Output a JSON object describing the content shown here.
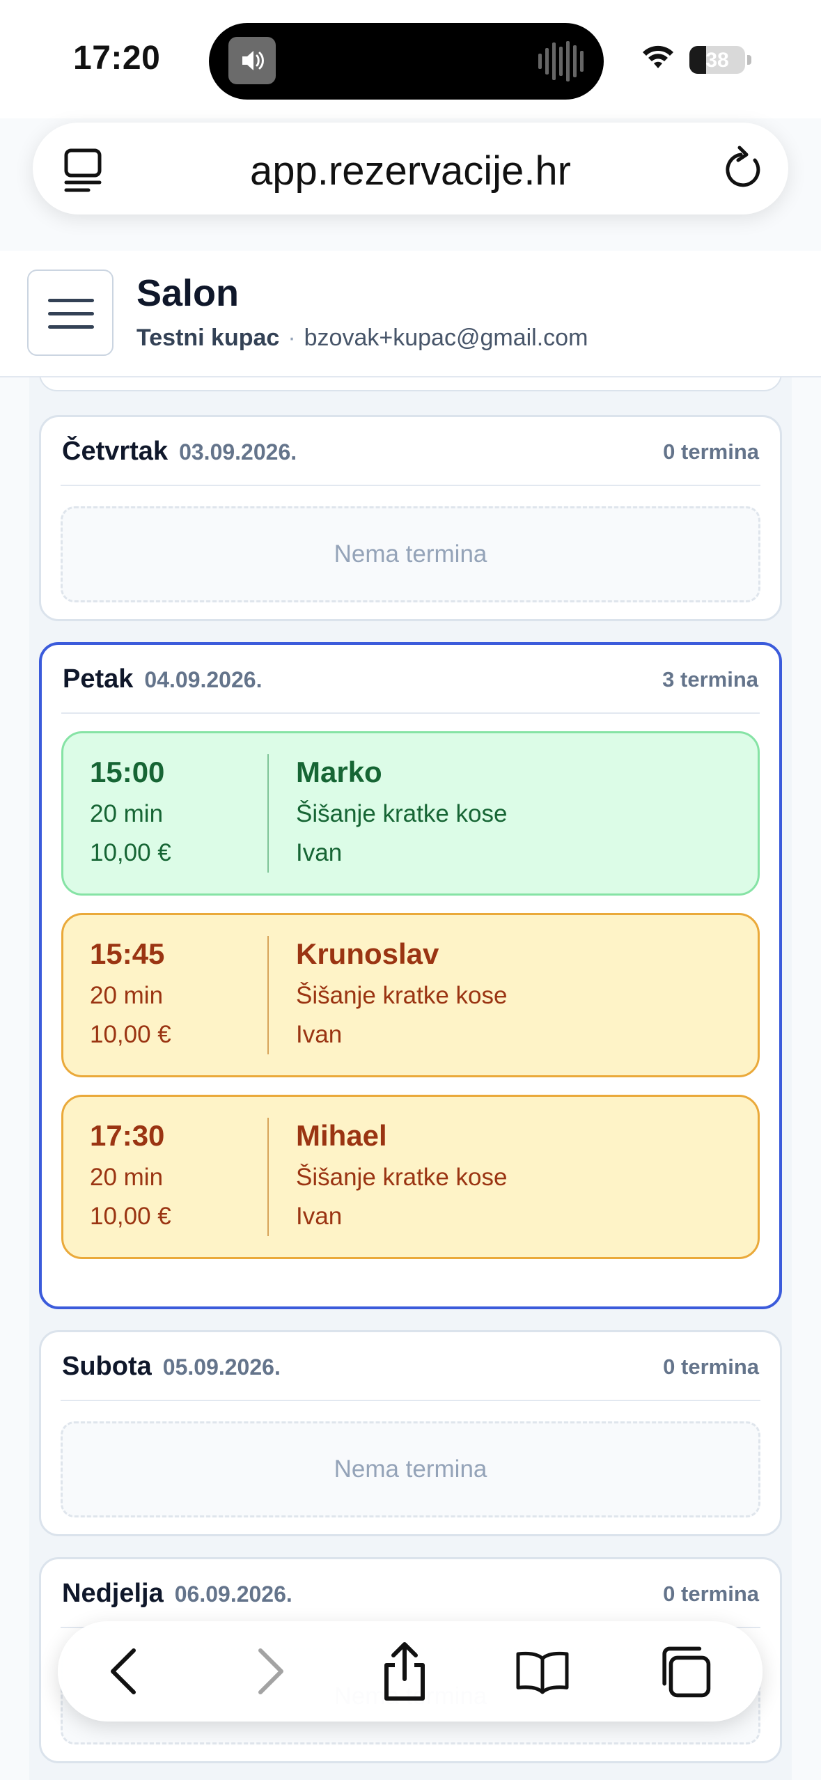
{
  "status_bar": {
    "time": "17:20",
    "battery": "38"
  },
  "browser": {
    "url": "app.rezervacije.hr"
  },
  "header": {
    "title": "Salon",
    "customer": "Testni kupac",
    "separator": "·",
    "email": "bzovak+kupac@gmail.com"
  },
  "days": [
    {
      "name": "Četvrtak",
      "date": "03.09.2026.",
      "count": "0 termina",
      "empty_text": "Nema termina"
    },
    {
      "name": "Petak",
      "date": "04.09.2026.",
      "count": "3 termina",
      "appointments": [
        {
          "time": "15:00",
          "duration": "20 min",
          "price": "10,00 €",
          "client": "Marko",
          "service": "Šišanje kratke kose",
          "staff": "Ivan",
          "status_color": "#dcfce7"
        },
        {
          "time": "15:45",
          "duration": "20 min",
          "price": "10,00 €",
          "client": "Krunoslav",
          "service": "Šišanje kratke kose",
          "staff": "Ivan",
          "status_color": "#fef3c7"
        },
        {
          "time": "17:30",
          "duration": "20 min",
          "price": "10,00 €",
          "client": "Mihael",
          "service": "Šišanje kratke kose",
          "staff": "Ivan",
          "status_color": "#fef3c7"
        }
      ]
    },
    {
      "name": "Subota",
      "date": "05.09.2026.",
      "count": "0 termina",
      "empty_text": "Nema termina"
    },
    {
      "name": "Nedjelja",
      "date": "06.09.2026.",
      "count": "0 termina",
      "empty_text": "Nema termina"
    }
  ],
  "toolbar": {
    "icons": [
      "back-icon",
      "forward-icon",
      "share-icon",
      "bookmarks-icon",
      "tabs-icon"
    ]
  },
  "colors": {
    "accent": "#3b5bdb",
    "confirmed": "#dcfce7",
    "pending": "#fef3c7"
  }
}
